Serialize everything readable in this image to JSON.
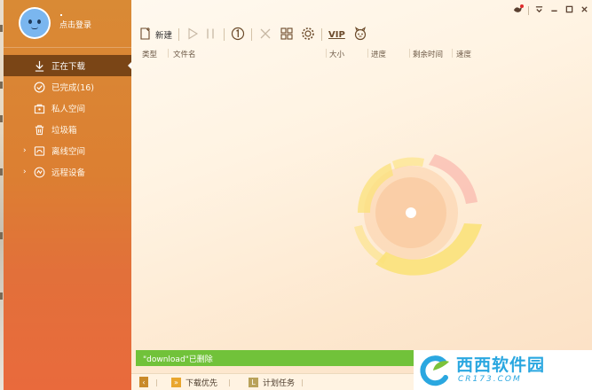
{
  "account": {
    "login_label": "点击登录"
  },
  "sidebar": {
    "items": [
      {
        "label": "正在下载",
        "icon": "download-icon",
        "active": true
      },
      {
        "label": "已完成(16)",
        "icon": "check-circle-icon",
        "active": false
      },
      {
        "label": "私人空间",
        "icon": "private-space-icon",
        "active": false
      },
      {
        "label": "垃圾箱",
        "icon": "trash-icon",
        "active": false
      },
      {
        "label": "离线空间",
        "icon": "offline-space-icon",
        "active": false,
        "expandable": true
      },
      {
        "label": "远程设备",
        "icon": "remote-device-icon",
        "active": false,
        "expandable": true
      }
    ]
  },
  "toolbar": {
    "new_label": "新建",
    "vip_label": "VIP"
  },
  "table": {
    "headers": [
      "类型",
      "文件名",
      "大小",
      "进度",
      "剩余时间",
      "速度"
    ]
  },
  "toast": {
    "message": "\"download\"已删除"
  },
  "bottom_bar": {
    "download_priority_label": "下载优先",
    "scheduled_task_label": "计划任务"
  },
  "watermark": {
    "brand": "西西软件园",
    "domain": "CR173.COM"
  },
  "colors": {
    "sidebar_top": "#d98a35",
    "sidebar_bottom": "#e96a3c",
    "active_item": "#7a4516",
    "toast_green": "#71c23a",
    "watermark_blue": "#2aa7e0",
    "watermark_orange": "#f07a1e"
  }
}
